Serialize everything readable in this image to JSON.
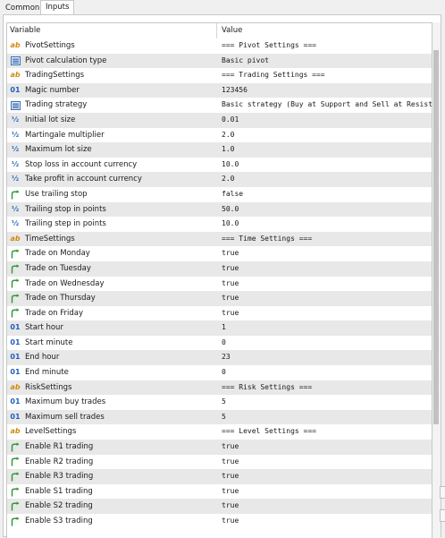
{
  "tabs": [
    "Common",
    "Inputs"
  ],
  "header": {
    "variable": "Variable",
    "value": "Value"
  },
  "rows": [
    {
      "icon": "ab",
      "name": "PivotSettings",
      "value": "=== Pivot Settings ==="
    },
    {
      "icon": "enum",
      "name": "Pivot calculation type",
      "value": "Basic pivot"
    },
    {
      "icon": "ab",
      "name": "TradingSettings",
      "value": "=== Trading Settings ==="
    },
    {
      "icon": "01",
      "name": "Magic number",
      "value": "123456"
    },
    {
      "icon": "enum",
      "name": "Trading strategy",
      "value": "Basic strategy (Buy at Support and Sell at Resistance)"
    },
    {
      "icon": "half",
      "name": "Initial lot size",
      "value": "0.01"
    },
    {
      "icon": "half",
      "name": "Martingale multiplier",
      "value": "2.0"
    },
    {
      "icon": "half",
      "name": "Maximum lot size",
      "value": "1.0"
    },
    {
      "icon": "half",
      "name": "Stop loss in account currency",
      "value": "10.0"
    },
    {
      "icon": "half",
      "name": "Take profit in account currency",
      "value": "2.0"
    },
    {
      "icon": "bool",
      "name": "Use trailing stop",
      "value": "false"
    },
    {
      "icon": "half",
      "name": "Trailing stop in points",
      "value": "50.0"
    },
    {
      "icon": "half",
      "name": "Trailing step in points",
      "value": "10.0"
    },
    {
      "icon": "ab",
      "name": "TimeSettings",
      "value": "=== Time Settings ==="
    },
    {
      "icon": "bool",
      "name": "Trade on Monday",
      "value": "true"
    },
    {
      "icon": "bool",
      "name": "Trade on Tuesday",
      "value": "true"
    },
    {
      "icon": "bool",
      "name": "Trade on Wednesday",
      "value": "true"
    },
    {
      "icon": "bool",
      "name": "Trade on Thursday",
      "value": "true"
    },
    {
      "icon": "bool",
      "name": "Trade on Friday",
      "value": "true"
    },
    {
      "icon": "01",
      "name": "Start hour",
      "value": "1"
    },
    {
      "icon": "01",
      "name": "Start minute",
      "value": "0"
    },
    {
      "icon": "01",
      "name": "End hour",
      "value": "23"
    },
    {
      "icon": "01",
      "name": "End minute",
      "value": "0"
    },
    {
      "icon": "ab",
      "name": "RiskSettings",
      "value": "=== Risk Settings ==="
    },
    {
      "icon": "01",
      "name": "Maximum buy trades",
      "value": "5"
    },
    {
      "icon": "01",
      "name": "Maximum sell trades",
      "value": "5"
    },
    {
      "icon": "ab",
      "name": "LevelSettings",
      "value": "=== Level Settings ==="
    },
    {
      "icon": "bool",
      "name": "Enable R1 trading",
      "value": "true"
    },
    {
      "icon": "bool",
      "name": "Enable R2 trading",
      "value": "true"
    },
    {
      "icon": "bool",
      "name": "Enable R3 trading",
      "value": "true"
    },
    {
      "icon": "bool",
      "name": "Enable S1 trading",
      "value": "true"
    },
    {
      "icon": "bool",
      "name": "Enable S2 trading",
      "value": "true"
    },
    {
      "icon": "bool",
      "name": "Enable S3 trading",
      "value": "true"
    }
  ],
  "icons": {
    "ab": "string-type-icon",
    "enum": "enum-type-icon",
    "01": "integer-type-icon",
    "half": "double-type-icon",
    "bool": "boolean-type-icon"
  },
  "colors": {
    "string_icon": "#d08a10",
    "integer_icon": "#1f5fbf",
    "enum_icon": "#3b6fb6",
    "bool_icon": "#2e9b3a",
    "row_alt": "#e8e8e8"
  }
}
